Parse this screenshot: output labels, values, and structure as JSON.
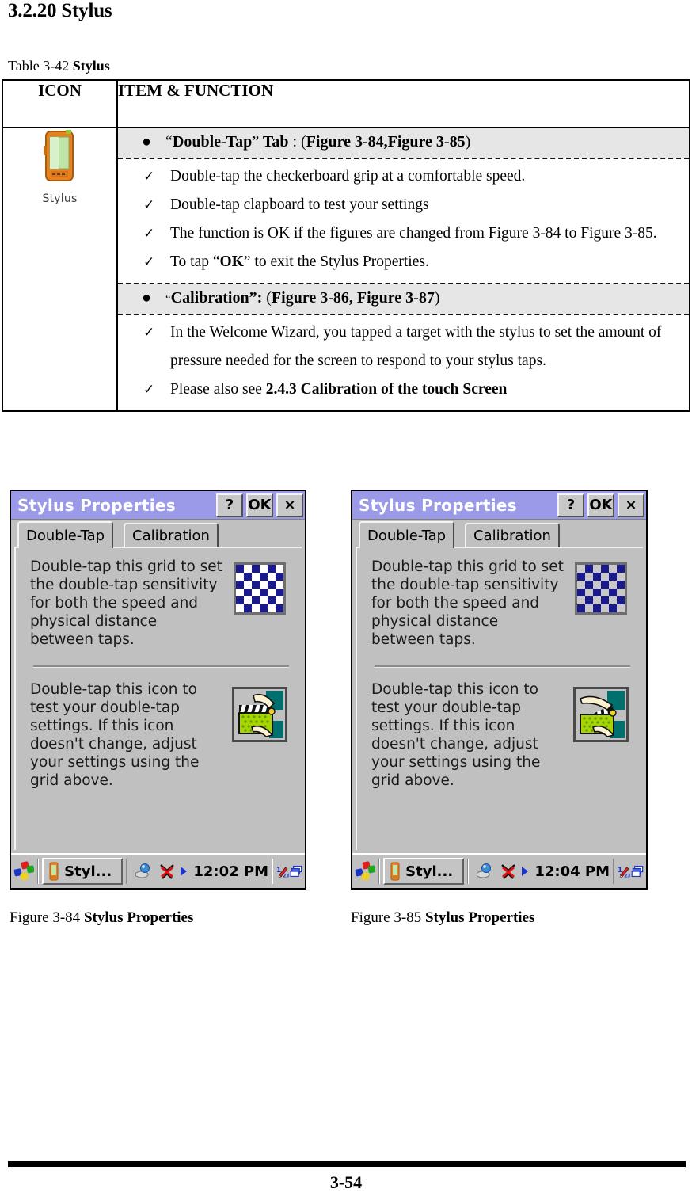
{
  "document": {
    "section_heading": "3.2.20 Stylus",
    "table_caption_prefix": "Table 3-42 ",
    "table_caption_bold": "Stylus",
    "page_number": "3-54"
  },
  "table": {
    "headers": {
      "icon": "ICON",
      "item_function": "ITEM & FUNCTION"
    },
    "icon_cell": {
      "icon_name": "stylus-pda-icon",
      "label": "Stylus"
    },
    "groups": [
      {
        "bullet": {
          "quote_open": "“",
          "bold_title": "Double-Tap",
          "quote_close": "”",
          "after_title": " Tab",
          "separator": " : (",
          "ref_a": "Figure 3-84,",
          "ref_b": "Figure 3-85",
          "tail": ")"
        },
        "items": [
          {
            "text": "Double-tap the checkerboard grip at a comfortable speed."
          },
          {
            "text": "Double-tap clapboard to test your settings"
          },
          {
            "text": "The function is OK if the figures are changed from Figure 3-84 to Figure 3-85."
          },
          {
            "text": "To tap “OK” to exit the Stylus Properties.",
            "bold_part": "OK"
          }
        ]
      },
      {
        "bullet": {
          "quote_open": "“",
          "bold_title": "Calibration",
          "quote_close": "”:",
          "after_title": "",
          "separator": " (",
          "ref_a": "Figure 3-86, ",
          "ref_b": "Figure 3-87",
          "tail": ")"
        },
        "items": [
          {
            "text": "In the Welcome Wizard, you tapped a target with the stylus to set the amount of pressure needed for the screen to respond to your stylus taps."
          },
          {
            "text": "Please also see 2.4.3 Calibration of the touch Screen",
            "bold_part": "2.4.3 Calibration of the touch Screen"
          }
        ]
      }
    ],
    "check_glyph": "✓",
    "bullet_glyph": "●"
  },
  "screenshots": [
    {
      "id": "figure-3-84",
      "window_title": "Stylus Properties",
      "titlebar_buttons": [
        {
          "name": "help-button",
          "label": "?"
        },
        {
          "name": "ok-button",
          "label": "OK"
        },
        {
          "name": "close-button",
          "label": "×"
        }
      ],
      "tabs": [
        {
          "label": "Double-Tap",
          "active": true
        },
        {
          "label": "Calibration",
          "active": false
        }
      ],
      "grid_text": "Double-tap this grid to set the double-tap sensitivity for both the speed and physical distance between taps.",
      "icon_text": "Double-tap this icon to test your double-tap settings. If this icon doesn't change, adjust your settings using the grid above.",
      "checker": {
        "rows": 6,
        "cols": 6,
        "dark_color": "#1a1a8c",
        "light_color": "#ffffff",
        "start_dark": true
      },
      "clapboard": {
        "state": "closed",
        "board_color": "#a8d400",
        "background_color": "#00706e",
        "clapper_color": "#111111"
      },
      "taskbar": {
        "start_icon": "windows-ce-start-icon",
        "task_button_label": "Styl...",
        "task_button_icon": "stylus-pda-icon",
        "tray_icons": [
          "network-icon",
          "antenna-disconnected-icon",
          "play-arrow-icon"
        ],
        "clock": "12:02 PM",
        "right_icons": [
          "input-panel-icon",
          "desktop-icon"
        ]
      },
      "caption_prefix": "Figure 3-84 ",
      "caption_bold": "Stylus Properties"
    },
    {
      "id": "figure-3-85",
      "window_title": "Stylus Properties",
      "titlebar_buttons": [
        {
          "name": "help-button",
          "label": "?"
        },
        {
          "name": "ok-button",
          "label": "OK"
        },
        {
          "name": "close-button",
          "label": "×"
        }
      ],
      "tabs": [
        {
          "label": "Double-Tap",
          "active": true
        },
        {
          "label": "Calibration",
          "active": false
        }
      ],
      "grid_text": "Double-tap this grid to set the double-tap sensitivity for both the speed and physical distance between taps.",
      "icon_text": "Double-tap this icon to test your double-tap settings. If this icon doesn't change, adjust your settings using the grid above.",
      "checker": {
        "rows": 6,
        "cols": 6,
        "dark_color": "#1a1a8c",
        "light_color": "#c8c8c8",
        "start_dark": false
      },
      "clapboard": {
        "state": "open",
        "board_color": "#a8d400",
        "background_color": "#00706e",
        "clapper_color": "#111111"
      },
      "taskbar": {
        "start_icon": "windows-ce-start-icon",
        "task_button_label": "Styl...",
        "task_button_icon": "stylus-pda-icon",
        "tray_icons": [
          "network-icon",
          "antenna-disconnected-icon",
          "play-arrow-icon"
        ],
        "clock": "12:04 PM",
        "right_icons": [
          "input-panel-icon",
          "desktop-icon"
        ]
      },
      "caption_prefix": "Figure 3-85 ",
      "caption_bold": "Stylus Properties"
    }
  ]
}
